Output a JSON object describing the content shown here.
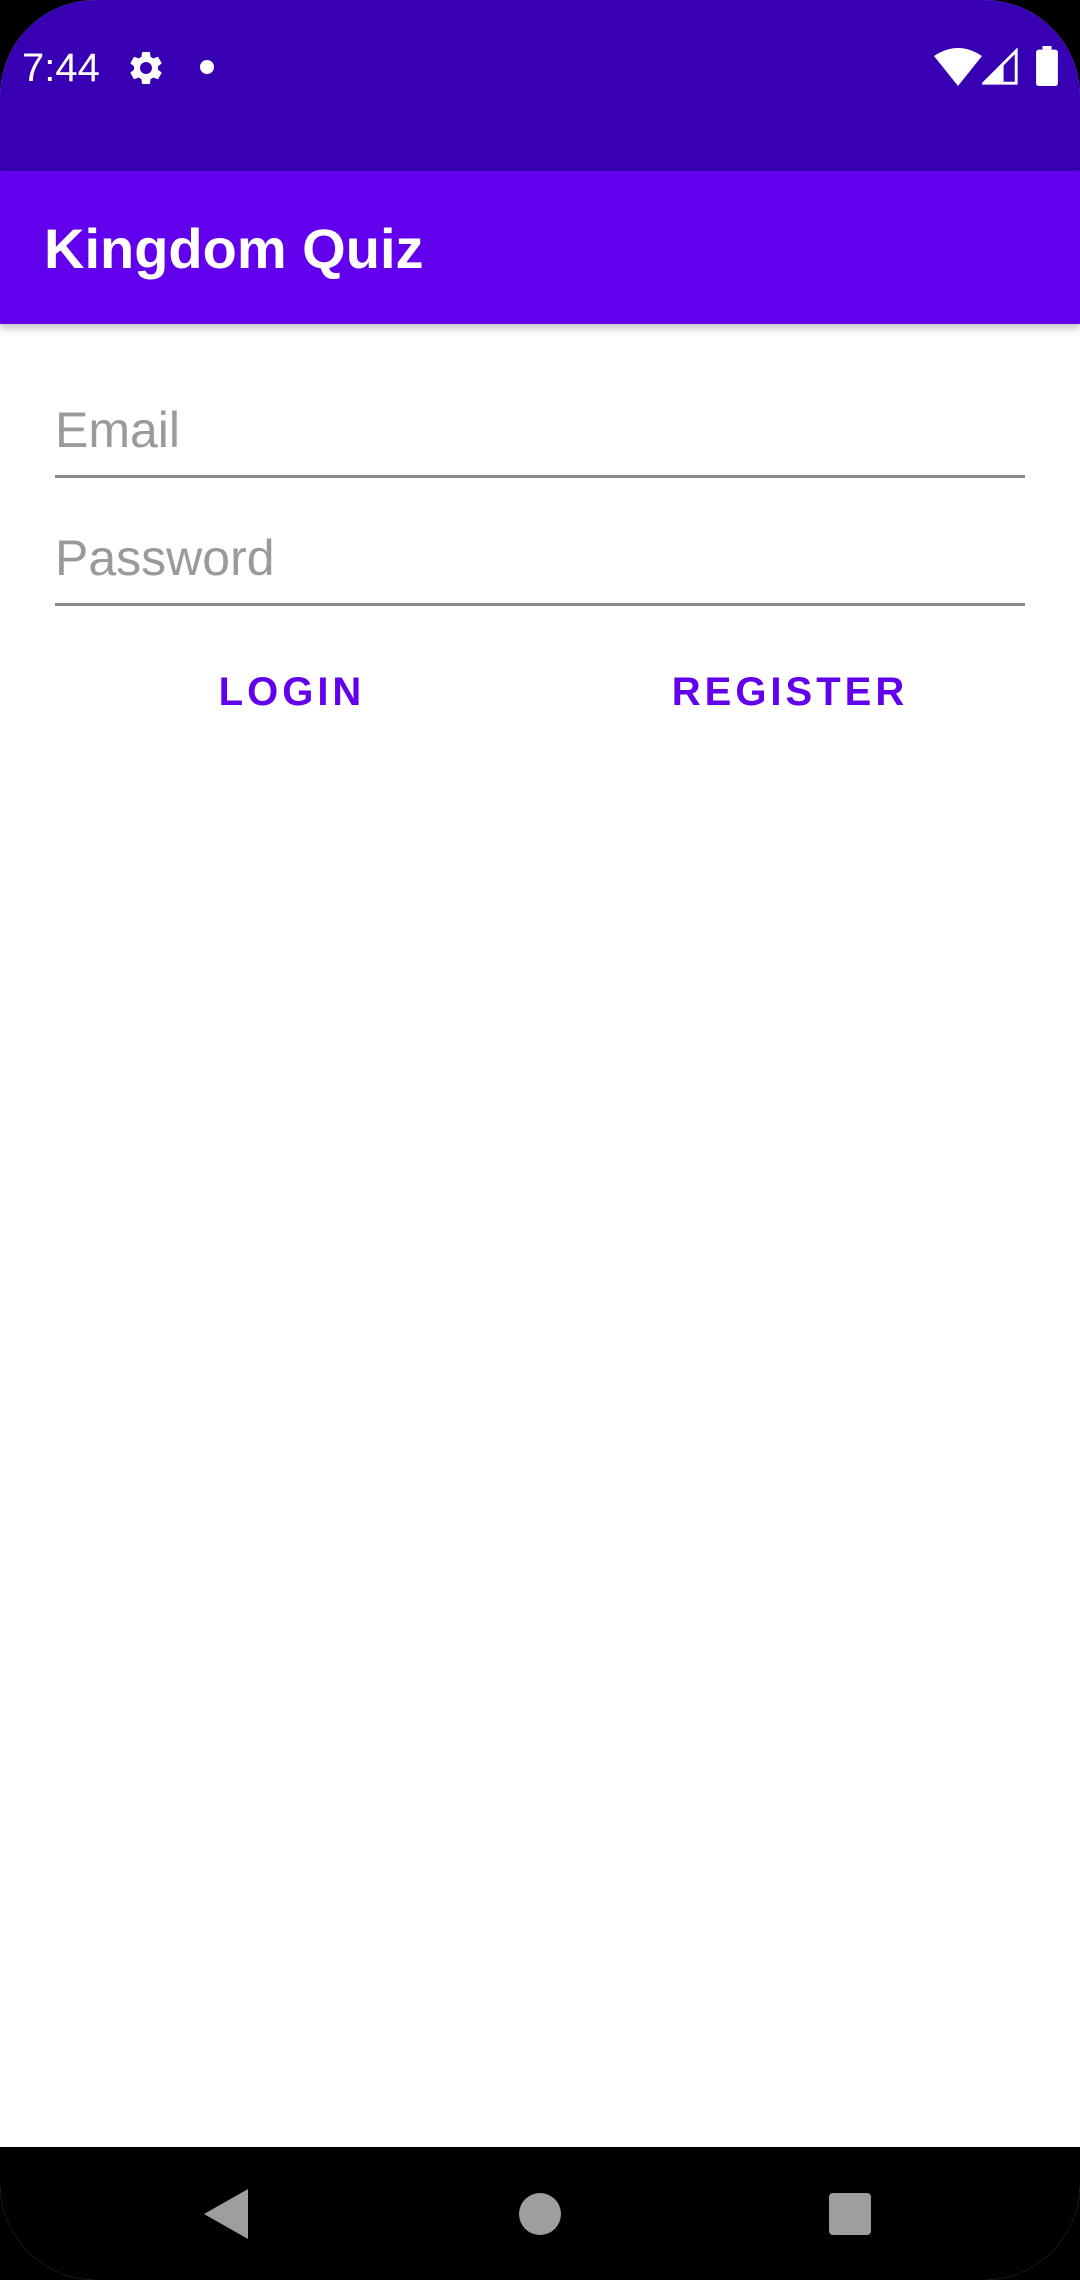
{
  "status_bar": {
    "time": "7:44",
    "icons": [
      "gear-icon",
      "notification-dot-icon",
      "wifi-icon",
      "cellular-signal-icon",
      "battery-icon"
    ],
    "background": "#3700b3"
  },
  "app_bar": {
    "title": "Kingdom Quiz",
    "background": "#6200ee"
  },
  "form": {
    "email": {
      "value": "",
      "placeholder": "Email"
    },
    "password": {
      "value": "",
      "placeholder": "Password"
    },
    "login_label": "LOGIN",
    "register_label": "REGISTER",
    "accent_color": "#6200ee"
  },
  "nav_bar": {
    "icons": [
      "back-icon",
      "home-icon",
      "recents-icon"
    ]
  }
}
